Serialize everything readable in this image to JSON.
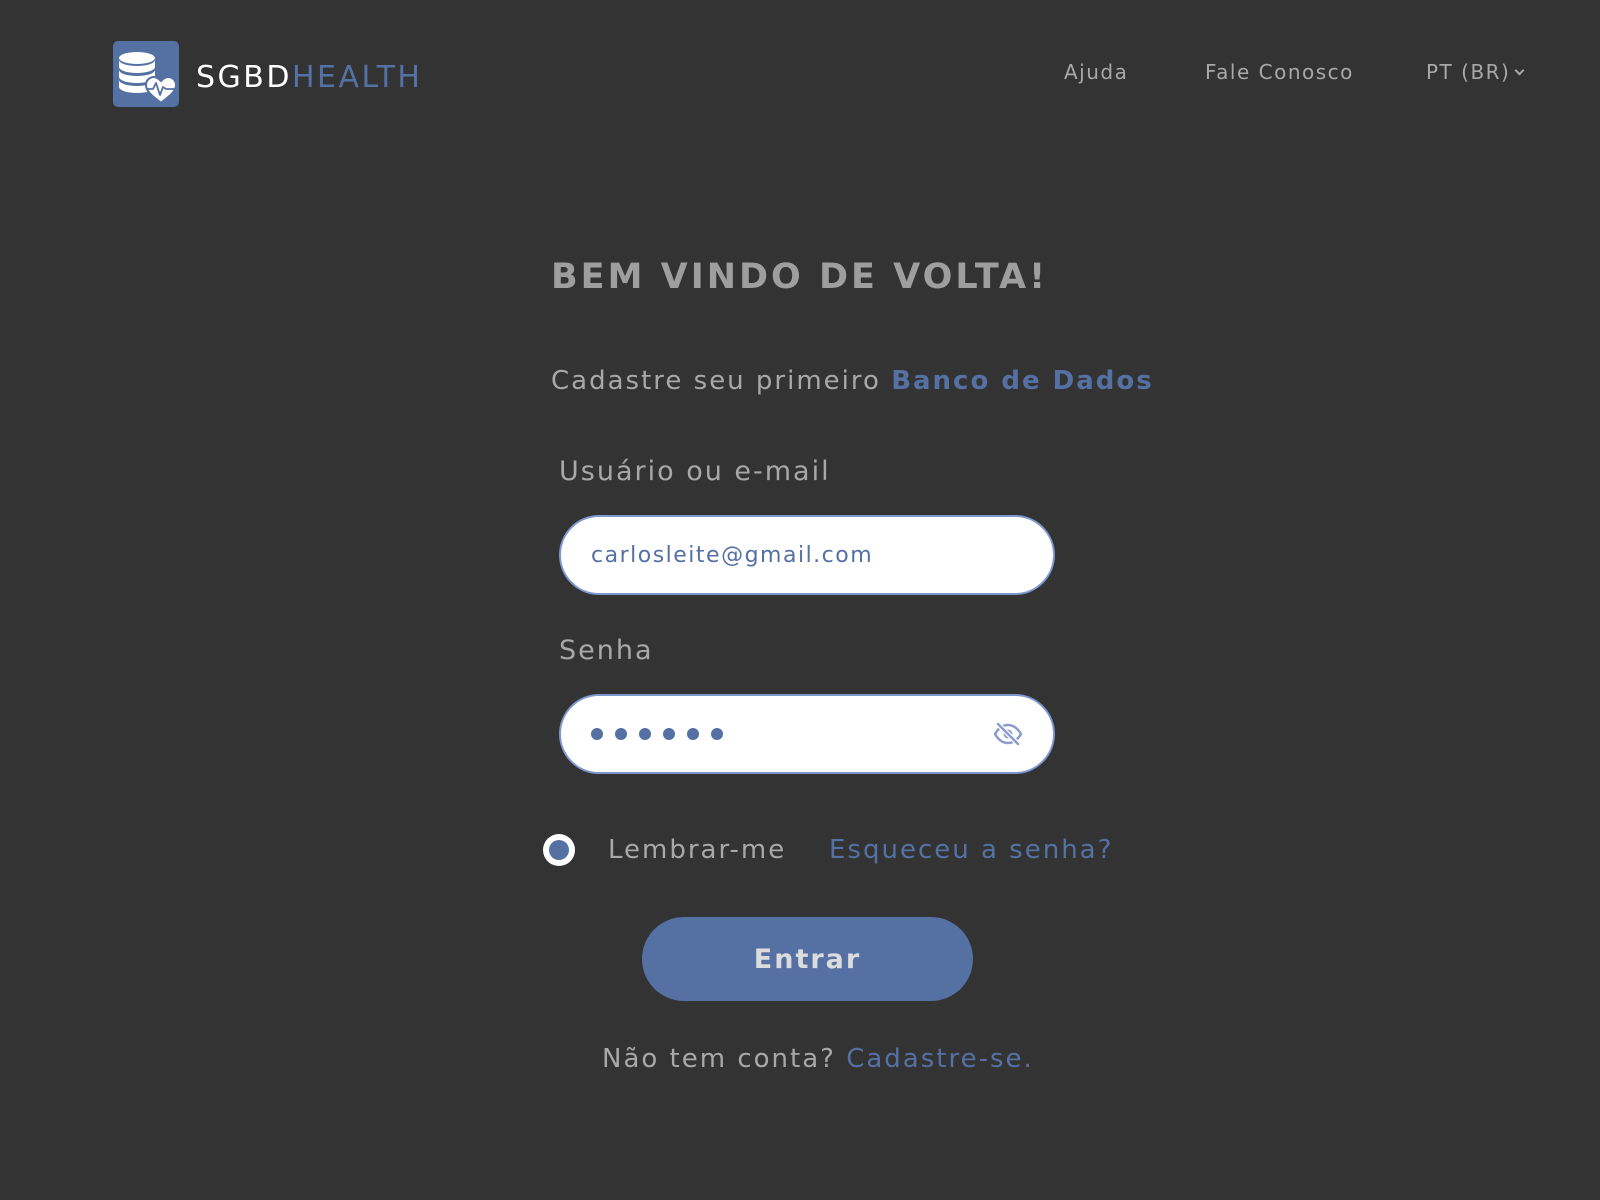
{
  "brand": {
    "name_part1": "SGBD",
    "name_part2": "HEALTH",
    "logo_icon": "database-heart-icon"
  },
  "nav": {
    "help": "Ajuda",
    "contact": "Fale Conosco",
    "language": "PT (BR)"
  },
  "login": {
    "title": "BEM VINDO DE VOLTA!",
    "subtitle_prefix": "Cadastre seu primeiro",
    "subtitle_link": "Banco de Dados",
    "user_label": "Usuário ou e-mail",
    "user_value": "carlosleite@gmail.com",
    "password_label": "Senha",
    "password_length": 6,
    "password_toggle_icon": "eye-slash-icon",
    "remember_label": "Lembrar-me",
    "remember_checked": true,
    "forgot_link": "Esqueceu a senha?",
    "submit_label": "Entrar",
    "signup_prefix": "Não tem conta?",
    "signup_link": "Cadastre-se."
  },
  "colors": {
    "background": "#333333",
    "accent": "#5570a3",
    "text_muted": "#a8a8a8",
    "input_border": "#7d97d0",
    "white": "#ffffff"
  }
}
